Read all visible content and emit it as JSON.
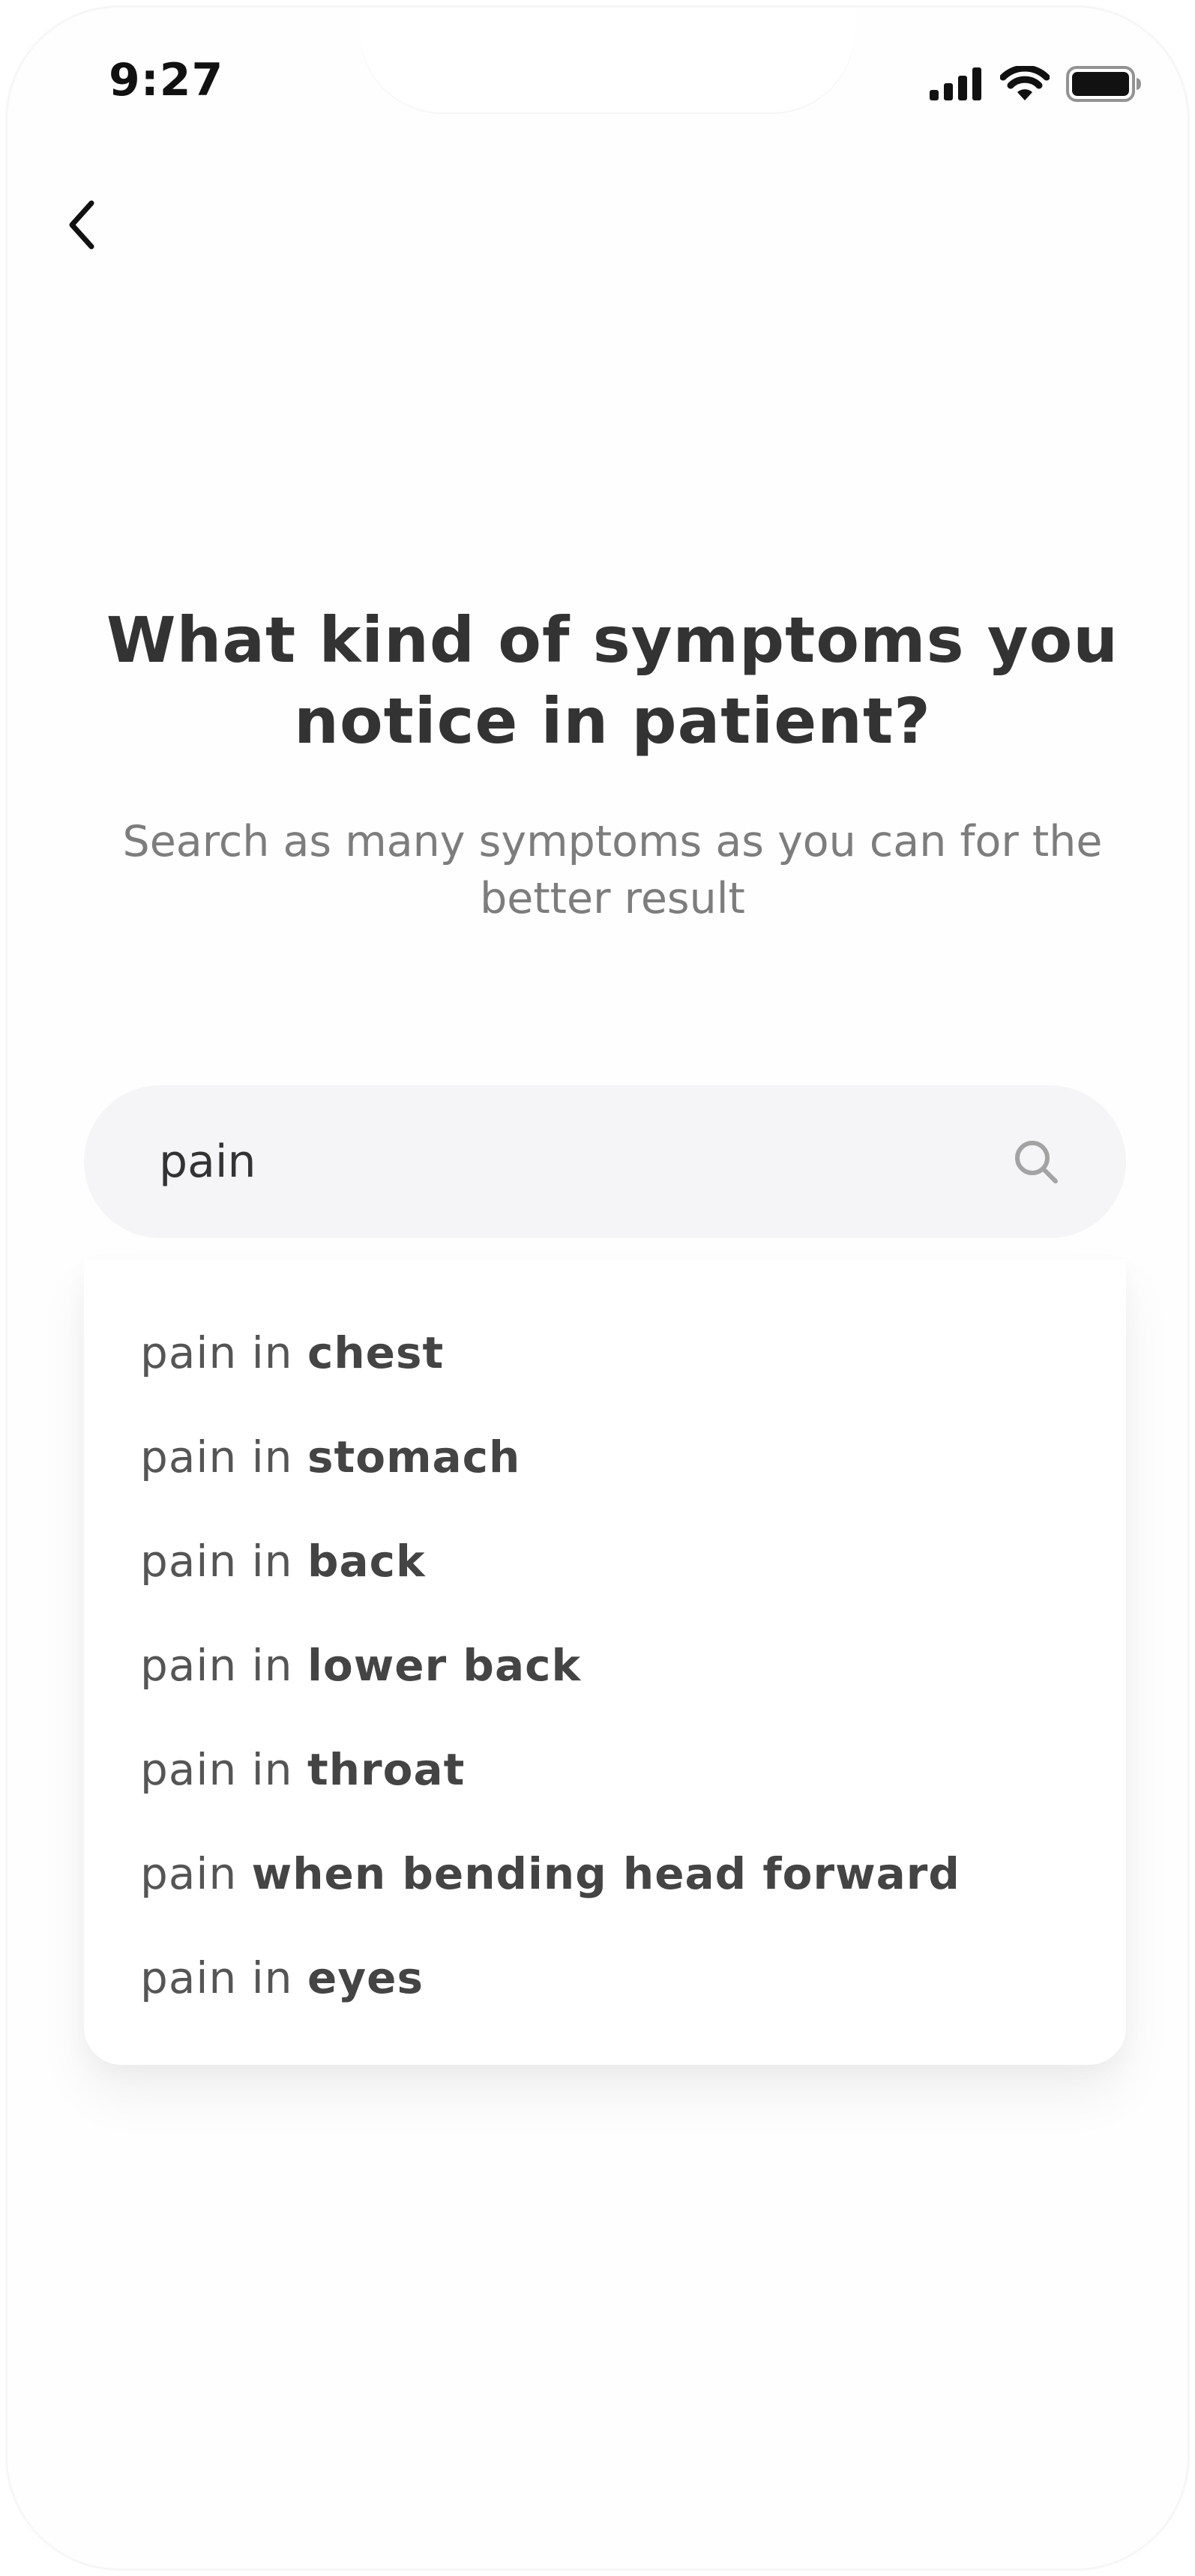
{
  "status_bar": {
    "time": "9:27"
  },
  "header": {
    "back_icon": "chevron-left-icon"
  },
  "main": {
    "title": "What kind of symptoms you notice in patient?",
    "subtitle": "Search as many symptoms as you can for the better result"
  },
  "search": {
    "value": "pain",
    "icon": "search-icon"
  },
  "suggestions": [
    {
      "prefix": "pain in ",
      "highlight": "chest"
    },
    {
      "prefix": "pain in ",
      "highlight": "stomach"
    },
    {
      "prefix": "pain in ",
      "highlight": "back"
    },
    {
      "prefix": "pain in ",
      "highlight": "lower back"
    },
    {
      "prefix": "pain in ",
      "highlight": "throat"
    },
    {
      "prefix": "pain ",
      "highlight": "when bending head forward"
    },
    {
      "prefix": "pain in ",
      "highlight": "eyes"
    }
  ],
  "colors": {
    "title": "#333333",
    "subtitle": "#7d7d7d",
    "search_bg": "#f5f5f7",
    "suggestion_text": "#555555"
  }
}
